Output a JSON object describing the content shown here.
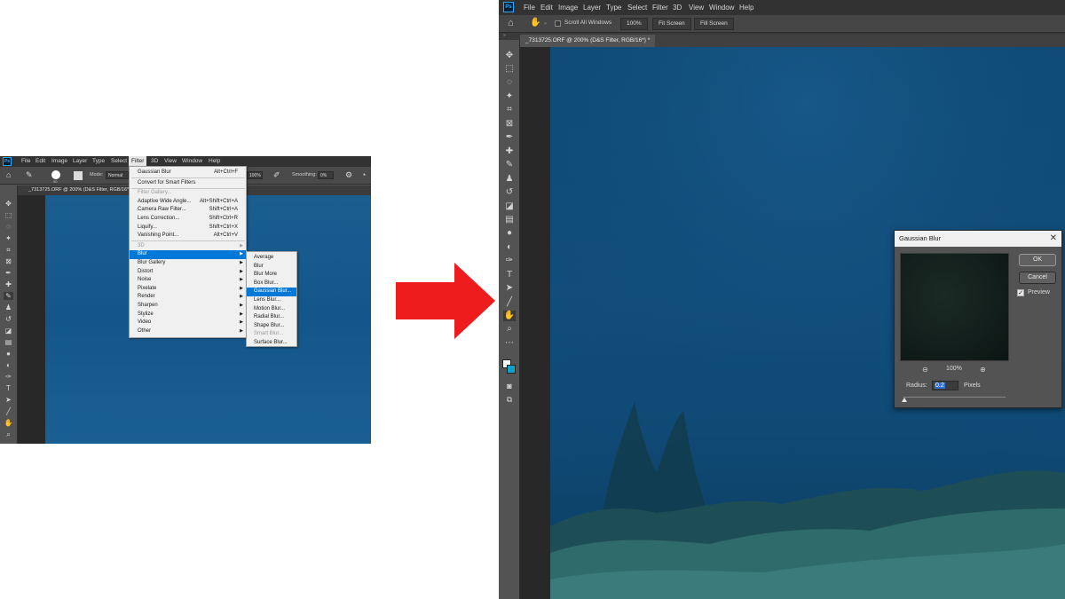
{
  "left_screenshot": {
    "menu": [
      "File",
      "Edit",
      "Image",
      "Layer",
      "Type",
      "Select",
      "Filter",
      "3D",
      "View",
      "Window",
      "Help"
    ],
    "active_menu": "Filter",
    "options": {
      "mode_label": "Mode:",
      "mode_value": "Normal",
      "brush_size": "90",
      "flow_value": "100%",
      "smoothing_label": "Smoothing:",
      "smoothing_value": "0%"
    },
    "doc_tab": "_7313725.ORF @ 200% (D&S Filter, RGB/16*) *",
    "filter_menu": [
      {
        "label": "Gaussian Blur",
        "shortcut": "Alt+Ctrl+F"
      },
      {
        "label": "Convert for Smart Filters",
        "shortcut": ""
      },
      {
        "label": "Filter Gallery...",
        "shortcut": "",
        "disabled": true
      },
      {
        "label": "Adaptive Wide Angle...",
        "shortcut": "Alt+Shift+Ctrl+A"
      },
      {
        "label": "Camera Raw Filter...",
        "shortcut": "Shift+Ctrl+A"
      },
      {
        "label": "Lens Correction...",
        "shortcut": "Shift+Ctrl+R"
      },
      {
        "label": "Liquify...",
        "shortcut": "Shift+Ctrl+X"
      },
      {
        "label": "Vanishing Point...",
        "shortcut": "Alt+Ctrl+V"
      },
      {
        "label": "3D",
        "shortcut": "",
        "disabled": true,
        "submenu": true
      },
      {
        "label": "Blur",
        "shortcut": "",
        "submenu": true,
        "selected": true
      },
      {
        "label": "Blur Gallery",
        "shortcut": "",
        "submenu": true
      },
      {
        "label": "Distort",
        "shortcut": "",
        "submenu": true
      },
      {
        "label": "Noise",
        "shortcut": "",
        "submenu": true
      },
      {
        "label": "Pixelate",
        "shortcut": "",
        "submenu": true
      },
      {
        "label": "Render",
        "shortcut": "",
        "submenu": true
      },
      {
        "label": "Sharpen",
        "shortcut": "",
        "submenu": true
      },
      {
        "label": "Stylize",
        "shortcut": "",
        "submenu": true
      },
      {
        "label": "Video",
        "shortcut": "",
        "submenu": true
      },
      {
        "label": "Other",
        "shortcut": "",
        "submenu": true
      }
    ],
    "blur_submenu": [
      {
        "label": "Average"
      },
      {
        "label": "Blur"
      },
      {
        "label": "Blur More"
      },
      {
        "label": "Box Blur..."
      },
      {
        "label": "Gaussian Blur...",
        "selected": true
      },
      {
        "label": "Lens Blur..."
      },
      {
        "label": "Motion Blur..."
      },
      {
        "label": "Radial Blur..."
      },
      {
        "label": "Shape Blur..."
      },
      {
        "label": "Smart Blur...",
        "disabled": true
      },
      {
        "label": "Surface Blur..."
      }
    ]
  },
  "right_screenshot": {
    "menu": [
      "File",
      "Edit",
      "Image",
      "Layer",
      "Type",
      "Select",
      "Filter",
      "3D",
      "View",
      "Window",
      "Help"
    ],
    "options": {
      "scroll_all": "Scroll All Windows",
      "zoom_btn": "100%",
      "fit_screen": "Fit Screen",
      "fill_screen": "Fill Screen"
    },
    "collapse_glyph": "»",
    "doc_tab": "_7313725.ORF @ 200% (D&S Filter, RGB/16*) *",
    "dialog": {
      "title": "Gaussian Blur",
      "ok": "OK",
      "cancel": "Cancel",
      "preview_label": "Preview",
      "preview_checked": true,
      "zoom_level": "100%",
      "radius_label": "Radius:",
      "radius_value": "0.2",
      "unit": "Pixels"
    }
  },
  "colors": {
    "arrow": "#ee1c1c",
    "selection": "#0078d7",
    "ps_blue": "#31a8ff"
  }
}
